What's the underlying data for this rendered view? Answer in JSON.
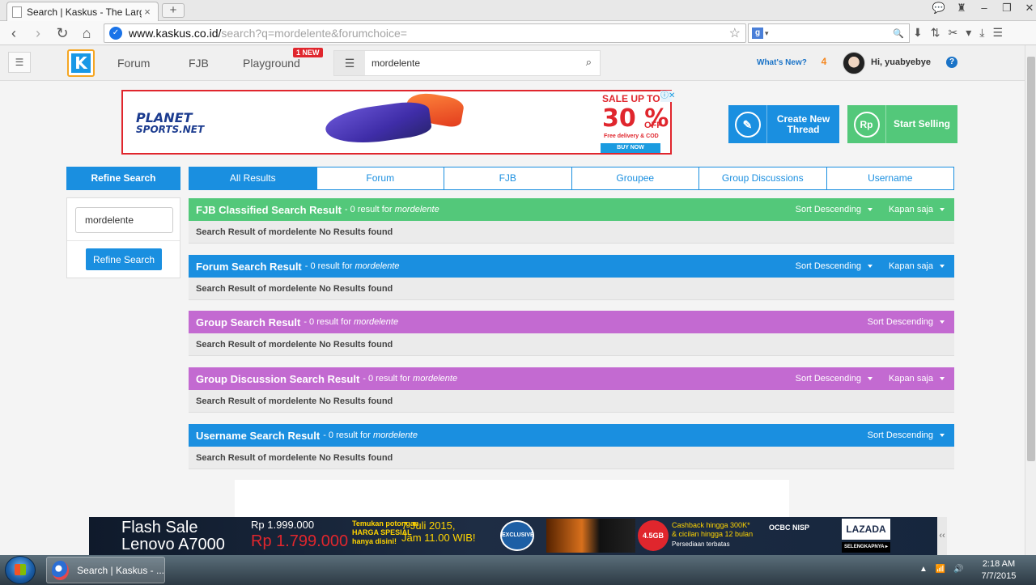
{
  "browser": {
    "tab_title": "Search | Kaskus - The Larg",
    "tab_close": "×",
    "new_tab": "+",
    "window_controls": [
      "💬",
      "♜",
      "–",
      "❐",
      "✕"
    ],
    "nav": {
      "back": "‹",
      "forward": "›",
      "reload": "↻",
      "home": "⌂"
    },
    "url_host": "www.kaskus.co.id/",
    "url_path": "search?q=mordelente&forumchoice=",
    "bookmark_icon": "☆",
    "search_engine_glyph": "g",
    "search_engine_caret": "▾",
    "search_icon": "🔍",
    "extensions": [
      "⬇",
      "⇅",
      "✂",
      "▾",
      "⤓",
      "☰"
    ]
  },
  "kaskus_header": {
    "menu_icon": "☰",
    "logo_glyph": "K",
    "nav": {
      "forum": "Forum",
      "fjb": "FJB",
      "playground": "Playground"
    },
    "new_badge": "1 NEW",
    "search_menu_icon": "☰",
    "search_value": "mordelente",
    "search_icon": "⌕",
    "whats_new": "What's New?",
    "notif_count": "4",
    "greeting": "Hi, yuabyebye",
    "help_icon": "?"
  },
  "ad": {
    "brand": "PLANET",
    "brand_sub": "SPORTS.NET",
    "sale_line": "SALE UP TO",
    "percent": "30 %",
    "off": "OFF",
    "free_delivery": "Free delivery & COD",
    "buy_now": "BUY NOW",
    "close": "ⓘ✕"
  },
  "cta": {
    "create_icon": "✎",
    "create_label_1": "Create New",
    "create_label_2": "Thread",
    "sell_icon": "Rp",
    "sell_label": "Start Selling"
  },
  "sidebar": {
    "title": "Refine Search",
    "input_value": "mordelente",
    "button": "Refine Search"
  },
  "tabs": [
    "All Results",
    "Forum",
    "FJB",
    "Groupee",
    "Group Discussions",
    "Username"
  ],
  "sections": [
    {
      "title": "FJB Classified Search Result",
      "count": "- 0 result for",
      "query": "mordelente",
      "sort": "Sort Descending",
      "time": "Kapan saja",
      "body": "Search Result of mordelente No Results found",
      "color": "#53c87a"
    },
    {
      "title": "Forum Search Result",
      "count": "- 0 result for",
      "query": "mordelente",
      "sort": "Sort Descending",
      "time": "Kapan saja",
      "body": "Search Result of mordelente No Results found",
      "color": "#1a8fe0"
    },
    {
      "title": "Group Search Result",
      "count": "- 0 result for",
      "query": "mordelente",
      "sort": "Sort Descending",
      "body": "Search Result of mordelente No Results found",
      "color": "#c36ad1"
    },
    {
      "title": "Group Discussion Search Result",
      "count": "- 0 result for",
      "query": "mordelente",
      "sort": "Sort Descending",
      "time": "Kapan saja",
      "body": "Search Result of mordelente No Results found",
      "color": "#c36ad1"
    },
    {
      "title": "Username Search Result",
      "count": "- 0 result for",
      "query": "mordelente",
      "sort": "Sort Descending",
      "body": "Search Result of mordelente No Results found",
      "color": "#1a8fe0"
    }
  ],
  "flash_ad": {
    "title_1": "Flash Sale",
    "title_2": "Lenovo A7000",
    "price_old": "Rp 1.999.000",
    "price_new": "Rp 1.799.000",
    "promo_1": "Temukan potongan",
    "promo_2": "HARGA SPESIAL",
    "promo_3": "hanya disini!",
    "date_1": "7 Juli 2015,",
    "date_2": "Jam 11.00 WIB!",
    "badge": "EXCLUSIVE",
    "gb": "4.5GB",
    "cash_1": "Cashback hingga 300K*",
    "cash_2": "& cicilan hingga 12 bulan",
    "stock": "Persediaan terbatas",
    "bank": "OCBC NISP",
    "brand": "LAZADA",
    "cta": "SELENGKAPNYA ▸",
    "collapse": "‹‹"
  },
  "taskbar": {
    "task_label": "Search | Kaskus - ...",
    "tray": [
      "▲",
      "📶",
      "🔊"
    ],
    "time": "2:18 AM",
    "date": "7/7/2015"
  }
}
